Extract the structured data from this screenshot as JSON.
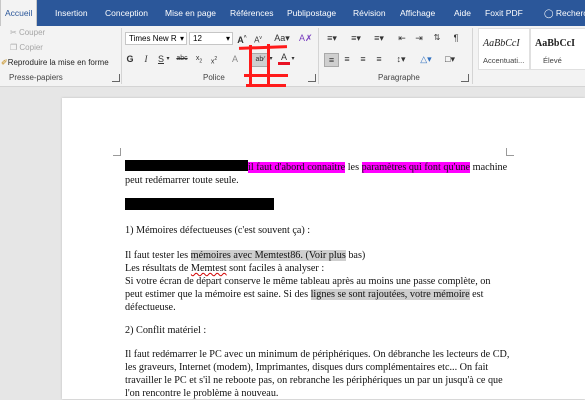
{
  "tabs": [
    "Accueil",
    "Insertion",
    "Conception",
    "Mise en page",
    "Références",
    "Publipostage",
    "Révision",
    "Affichage",
    "Aide",
    "Foxit PDF",
    "Recherche"
  ],
  "clipboard": {
    "cut": "Couper",
    "copy": "Copier",
    "format_painter": "Reproduire la mise en forme",
    "group_label": "Presse-papiers"
  },
  "font": {
    "name": "Times New R",
    "size": "12",
    "case_button": "Aa",
    "group_label": "Police"
  },
  "paragraph": {
    "group_label": "Paragraphe"
  },
  "styles": [
    {
      "sample": "AaBbCcI",
      "name": "Accentuati..."
    },
    {
      "sample": "AaBbCcI",
      "name": "Élevé"
    }
  ],
  "document": {
    "line1_highlight": "il faut d'abord connaitre",
    "line1_mid": " les ",
    "line1_highlight2": "paramètres qui font qu'une",
    "line1_end": " machine",
    "line2": "peut redémarrer toute seule.",
    "section1_title": "1) Mémoires défectueuses (c'est souvent ça) :",
    "p1_pre": "Il faut tester les ",
    "p1_highlight": "mémoires avec Memtest86. (Voir plus",
    "p1_post": " bas)",
    "p2_pre": "Les résultats de ",
    "p2_squig": "Memtest",
    "p2_post": " sont faciles à analyser :",
    "p3": "Si votre écran de départ conserve le même tableau après au moins une passe complète, on",
    "p4_pre": "peut estimer que la mémoire est saine. Si des ",
    "p4_highlight": "lignes se sont rajoutées, votre mémoire",
    "p4_post": " est",
    "p5": "défectueuse.",
    "section2_title": "2) Conflit matériel :",
    "q1": "Il faut redémarrer le PC avec un minimum de périphériques. On débranche les lecteurs de CD,",
    "q2": "les graveurs, Internet (modem), Imprimantes, disques durs complémentaires etc... On fait",
    "q3": "travailler le PC et s'il ne reboote pas, on rebranche les périphériques un par un jusqu'à ce que",
    "q4": "l'on rencontre le problème à nouveau."
  }
}
